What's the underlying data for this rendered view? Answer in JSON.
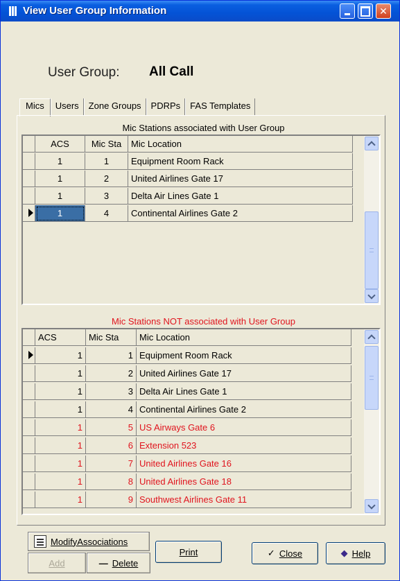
{
  "window": {
    "title": "View User Group Information"
  },
  "user_group": {
    "label": "User Group:",
    "value": "All Call"
  },
  "tabs": [
    {
      "label": "Mics"
    },
    {
      "label": "Users"
    },
    {
      "label": "Zone Groups"
    },
    {
      "label": "PDRPs"
    },
    {
      "label": "FAS Templates"
    }
  ],
  "associated": {
    "caption": "Mic Stations associated with User Group",
    "headers": [
      "ACS",
      "Mic Sta",
      "Mic Location"
    ],
    "rows": [
      [
        "1",
        "1",
        "Equipment Room Rack"
      ],
      [
        "1",
        "2",
        "United Airlines Gate 17"
      ],
      [
        "1",
        "3",
        "Delta Air Lines Gate 1"
      ],
      [
        "1",
        "4",
        "Continental Airlines Gate 2"
      ]
    ]
  },
  "not_associated": {
    "caption": "Mic Stations NOT associated with User Group",
    "caption_color": "#e0141e",
    "headers": [
      "ACS",
      "Mic Sta",
      "Mic Location"
    ],
    "rows": [
      [
        "1",
        "1",
        "Equipment Room Rack"
      ],
      [
        "1",
        "2",
        "United Airlines Gate 17"
      ],
      [
        "1",
        "3",
        "Delta Air Lines Gate 1"
      ],
      [
        "1",
        "4",
        "Continental Airlines Gate 2"
      ],
      [
        "1",
        "5",
        "US Airways Gate 6"
      ],
      [
        "1",
        "6",
        "Extension 523"
      ],
      [
        "1",
        "7",
        "United Airlines Gate 16"
      ],
      [
        "1",
        "8",
        "United Airlines Gate 18"
      ],
      [
        "1",
        "9",
        "Southwest Airlines Gate 11"
      ]
    ]
  },
  "buttons": {
    "modify": "ModifyAssociations",
    "add": "Add",
    "delete": "Delete",
    "print": "Print",
    "close": "Close",
    "help": "Help"
  }
}
